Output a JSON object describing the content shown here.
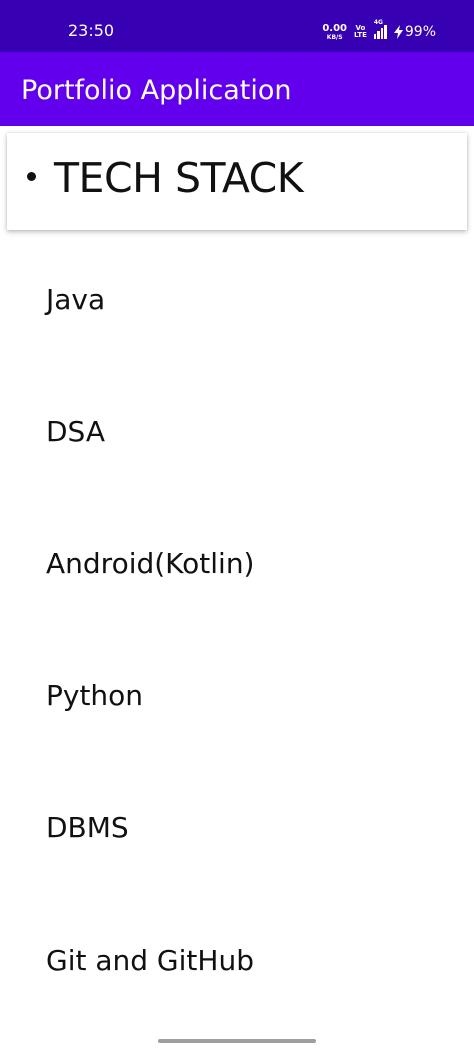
{
  "status_bar": {
    "time": "23:50",
    "net_speed_value": "0.00",
    "net_speed_unit": "KB/S",
    "volte_top": "Vo",
    "volte_bottom": "LTE",
    "network_type": "4G",
    "battery": "99%"
  },
  "app_bar": {
    "title": "Portfolio Application"
  },
  "section": {
    "title": "TECH STACK"
  },
  "tech_stack": [
    "Java",
    "DSA",
    "Android(Kotlin)",
    "Python",
    "DBMS",
    "Git and GitHub"
  ],
  "colors": {
    "status_bar": "#3700b3",
    "app_bar": "#6200ee",
    "background": "#ffffff",
    "text": "#111111"
  },
  "icons": [
    "signal-icon",
    "bolt-icon",
    "bullet-icon"
  ]
}
